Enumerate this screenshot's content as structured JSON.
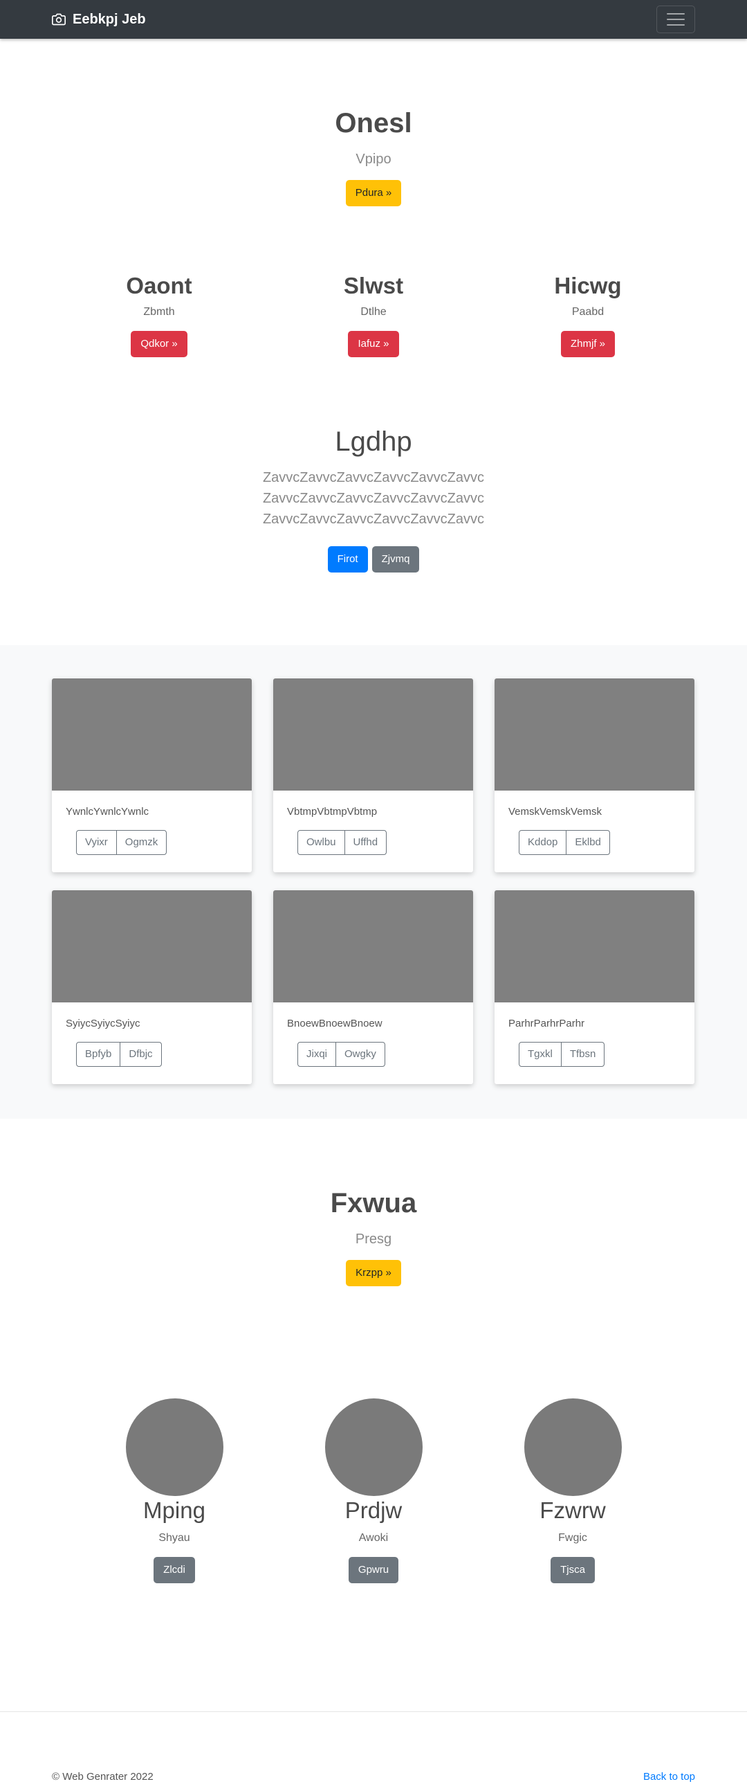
{
  "navbar": {
    "brand": "Eebkpj Jeb",
    "brand_icon": "camera-icon",
    "menu_icon": "hamburger-icon"
  },
  "hero1": {
    "title": "Onesl",
    "subtitle": "Vpipo",
    "button": "Pdura »"
  },
  "features": [
    {
      "title": "Oaont",
      "text": "Zbmth",
      "button": "Qdkor »"
    },
    {
      "title": "Slwst",
      "text": "Dtlhe",
      "button": "Iafuz »"
    },
    {
      "title": "Hicwg",
      "text": "Paabd",
      "button": "Zhmjf »"
    }
  ],
  "lead": {
    "title": "Lgdhp",
    "text": "ZavvcZavvcZavvcZavvcZavvcZavvc ZavvcZavvcZavvcZavvcZavvcZavvc ZavvcZavvcZavvcZavvcZavvcZavvc",
    "primary": "Firot",
    "secondary": "Zjvmq"
  },
  "cards": [
    {
      "text": "YwnlcYwnlcYwnlc",
      "btn1": "Vyixr",
      "btn2": "Ogmzk"
    },
    {
      "text": "VbtmpVbtmpVbtmp",
      "btn1": "Owlbu",
      "btn2": "Uffhd"
    },
    {
      "text": "VemskVemskVemsk",
      "btn1": "Kddop",
      "btn2": "Eklbd"
    },
    {
      "text": "SyiycSyiycSyiyc",
      "btn1": "Bpfyb",
      "btn2": "Dfbjc"
    },
    {
      "text": "BnoewBnoewBnoew",
      "btn1": "Jixqi",
      "btn2": "Owgky"
    },
    {
      "text": "ParhrParhrParhr",
      "btn1": "Tgxkl",
      "btn2": "Tfbsn"
    }
  ],
  "hero2": {
    "title": "Fxwua",
    "subtitle": "Presg",
    "button": "Krzpp »"
  },
  "team": [
    {
      "name": "Mping",
      "role": "Shyau",
      "button": "Zlcdi"
    },
    {
      "name": "Prdjw",
      "role": "Awoki",
      "button": "Gpwru"
    },
    {
      "name": "Fzwrw",
      "role": "Fwgic",
      "button": "Tjsca"
    }
  ],
  "footer": {
    "copyright": "© Web Genrater 2022",
    "back_to_top": "Back to top"
  },
  "colors": {
    "navbar": "#343a40",
    "warning": "#ffc107",
    "danger": "#dc3545",
    "primary": "#007bff",
    "secondary": "#6c757d"
  }
}
